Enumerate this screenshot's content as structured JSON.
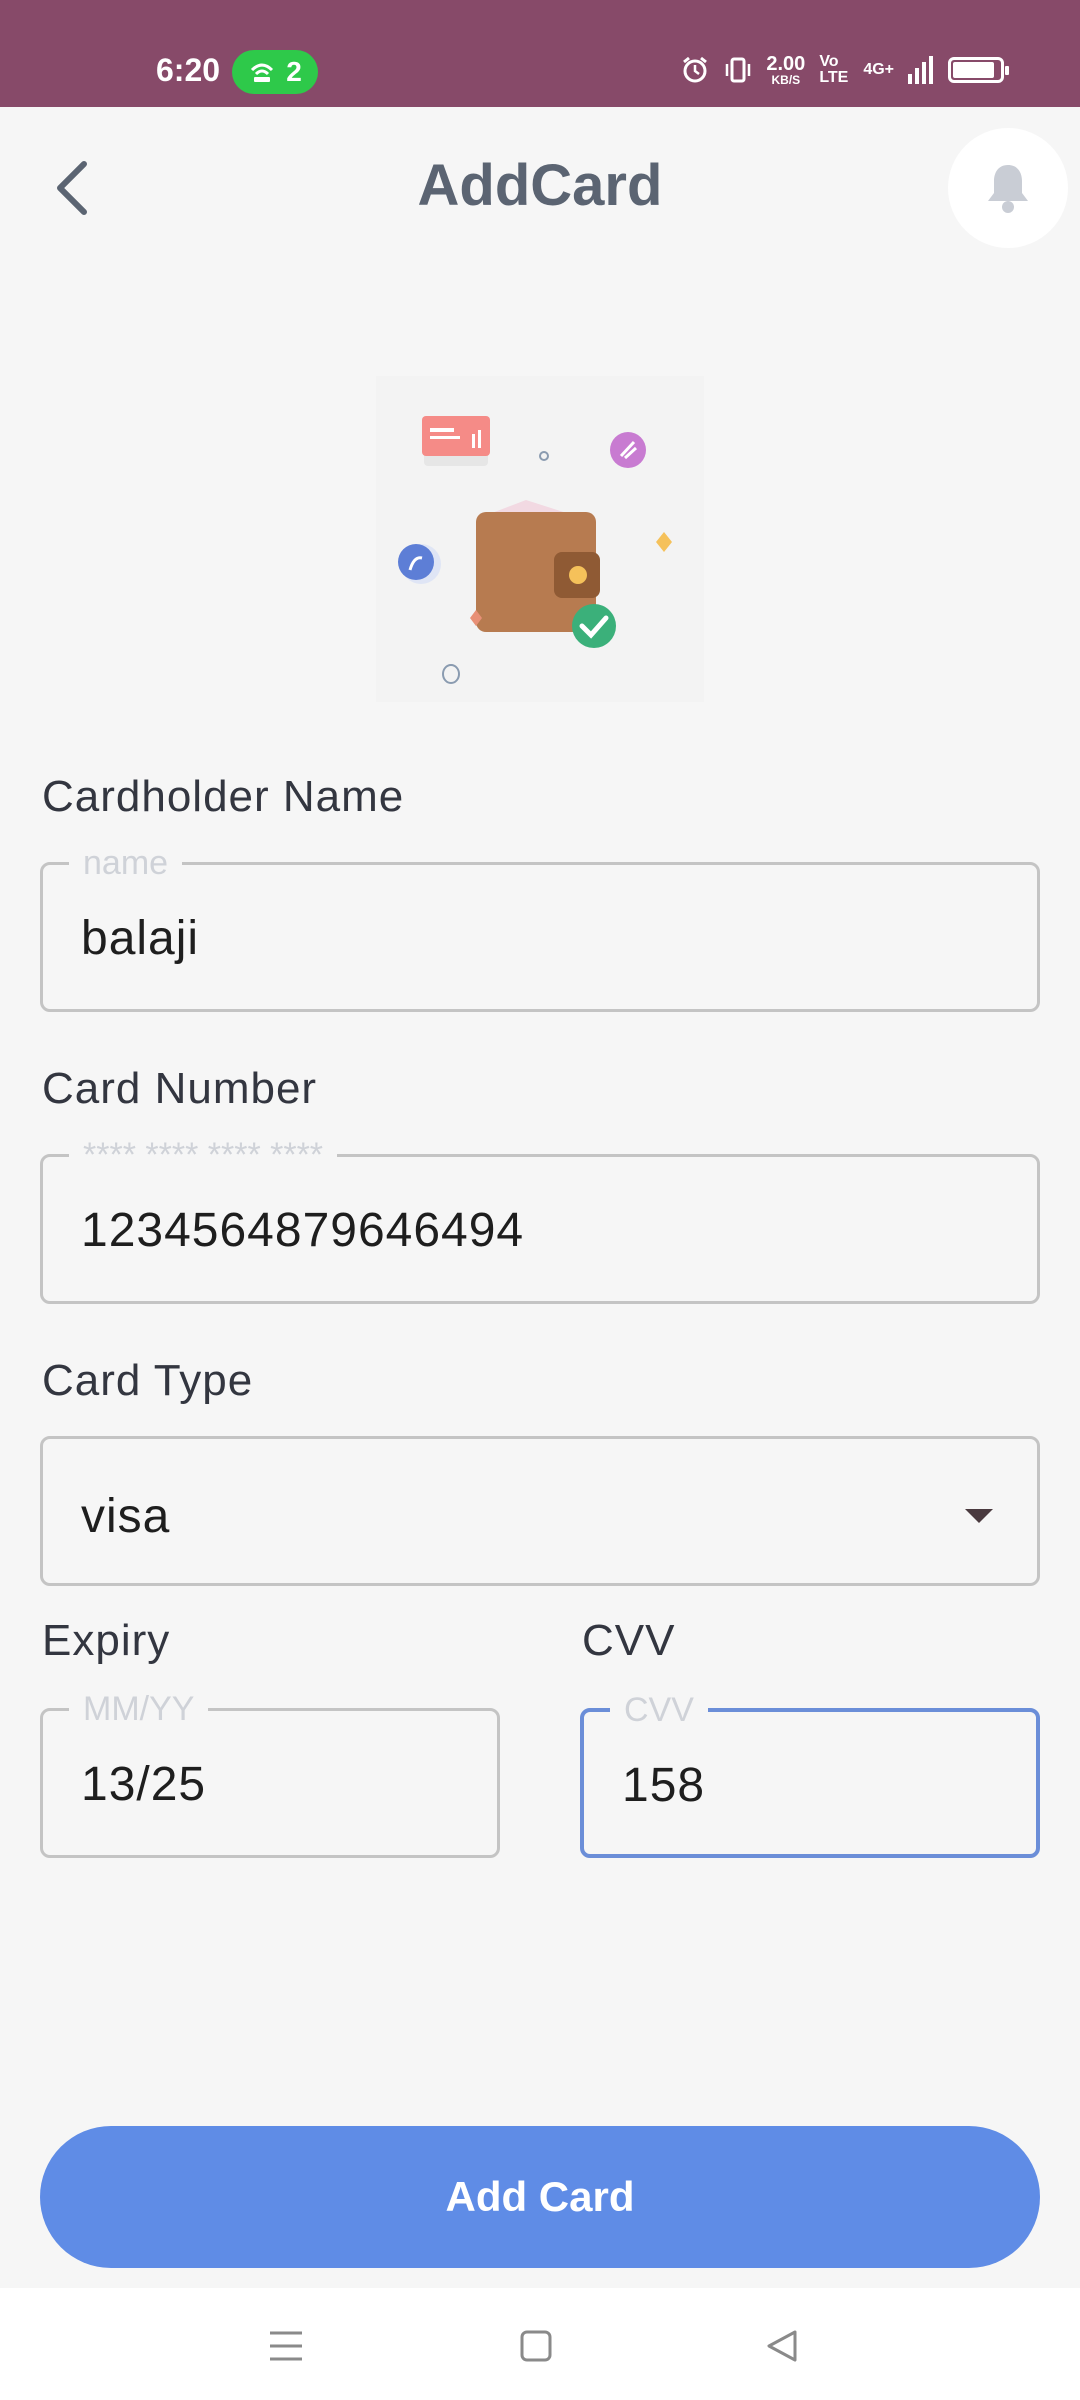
{
  "status_bar": {
    "time": "6:20",
    "hotspot_count": "2",
    "net_speed": "2.00",
    "net_speed_unit": "KB/S",
    "volte": "Vo LTE",
    "network": "4G+",
    "bg_color": "#874a69"
  },
  "header": {
    "title": "AddCard",
    "back_icon": "chevron-left-icon",
    "notification_icon": "bell-icon"
  },
  "illustration": {
    "icon": "wallet-with-cards-illustration"
  },
  "form": {
    "cardholder": {
      "label": "Cardholder Name",
      "placeholder": "name",
      "value": "balaji"
    },
    "card_number": {
      "label": "Card Number",
      "placeholder": "**** **** **** ****",
      "value": "1234564879646494"
    },
    "card_type": {
      "label": "Card Type",
      "value": "visa"
    },
    "expiry": {
      "label": "Expiry",
      "placeholder": "MM/YY",
      "value": "13/25"
    },
    "cvv": {
      "label": "CVV",
      "placeholder": "CVV",
      "value": "158"
    }
  },
  "submit": {
    "label": "Add Card",
    "color": "#5f8ce6"
  },
  "nav": {
    "menu_icon": "menu-icon",
    "home_icon": "home-square-icon",
    "back_icon": "back-triangle-icon"
  }
}
